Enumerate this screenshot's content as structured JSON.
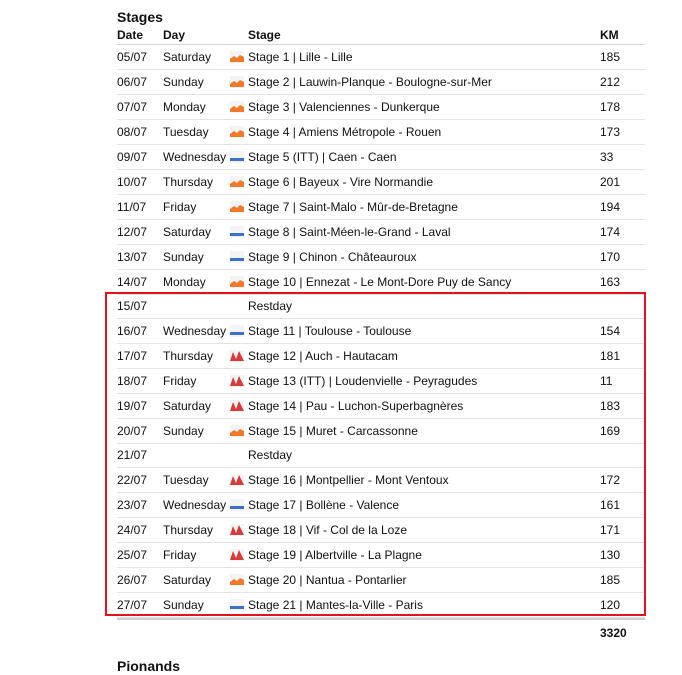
{
  "section_title": "Stages",
  "columns": {
    "date": "Date",
    "day": "Day",
    "stage": "Stage",
    "km": "KM"
  },
  "stages": [
    {
      "date": "05/07",
      "day": "Saturday",
      "icon": "hilly-profile-icon",
      "stage": "Stage 1 | Lille - Lille",
      "km": "185"
    },
    {
      "date": "06/07",
      "day": "Sunday",
      "icon": "hilly-profile-icon",
      "stage": "Stage 2 | Lauwin-Planque - Boulogne-sur-Mer",
      "km": "212"
    },
    {
      "date": "07/07",
      "day": "Monday",
      "icon": "hilly-profile-icon",
      "stage": "Stage 3 | Valenciennes - Dunkerque",
      "km": "178"
    },
    {
      "date": "08/07",
      "day": "Tuesday",
      "icon": "hilly-profile-icon",
      "stage": "Stage 4 | Amiens Métropole - Rouen",
      "km": "173"
    },
    {
      "date": "09/07",
      "day": "Wednesday",
      "icon": "flat-profile-icon",
      "stage": "Stage 5 (ITT) | Caen - Caen",
      "km": "33"
    },
    {
      "date": "10/07",
      "day": "Thursday",
      "icon": "hilly-profile-icon",
      "stage": "Stage 6 | Bayeux - Vire Normandie",
      "km": "201"
    },
    {
      "date": "11/07",
      "day": "Friday",
      "icon": "hilly-profile-icon",
      "stage": "Stage 7 | Saint-Malo - Mûr-de-Bretagne",
      "km": "194"
    },
    {
      "date": "12/07",
      "day": "Saturday",
      "icon": "flat-profile-icon",
      "stage": "Stage 8 | Saint-Méen-le-Grand - Laval",
      "km": "174"
    },
    {
      "date": "13/07",
      "day": "Sunday",
      "icon": "flat-profile-icon",
      "stage": "Stage 9 | Chinon - Châteauroux",
      "km": "170"
    },
    {
      "date": "14/07",
      "day": "Monday",
      "icon": "hilly-profile-icon",
      "stage": "Stage 10 | Ennezat - Le Mont-Dore Puy de Sancy",
      "km": "163"
    },
    {
      "date": "15/07",
      "day": "",
      "icon": "",
      "stage": "Restday",
      "km": "",
      "rest": true
    },
    {
      "date": "16/07",
      "day": "Wednesday",
      "icon": "flat-profile-icon",
      "stage": "Stage 11 | Toulouse - Toulouse",
      "km": "154"
    },
    {
      "date": "17/07",
      "day": "Thursday",
      "icon": "mountain-profile-icon",
      "stage": "Stage 12 | Auch - Hautacam",
      "km": "181"
    },
    {
      "date": "18/07",
      "day": "Friday",
      "icon": "mountain-profile-icon",
      "stage": "Stage 13 (ITT) | Loudenvielle - Peyragudes",
      "km": "11"
    },
    {
      "date": "19/07",
      "day": "Saturday",
      "icon": "mountain-profile-icon",
      "stage": "Stage 14 | Pau - Luchon-Superbagnères",
      "km": "183"
    },
    {
      "date": "20/07",
      "day": "Sunday",
      "icon": "hilly-profile-icon",
      "stage": "Stage 15 | Muret - Carcassonne",
      "km": "169"
    },
    {
      "date": "21/07",
      "day": "",
      "icon": "",
      "stage": "Restday",
      "km": "",
      "rest": true
    },
    {
      "date": "22/07",
      "day": "Tuesday",
      "icon": "mountain-profile-icon",
      "stage": "Stage 16 | Montpellier - Mont Ventoux",
      "km": "172"
    },
    {
      "date": "23/07",
      "day": "Wednesday",
      "icon": "flat-profile-icon",
      "stage": "Stage 17 | Bollène - Valence",
      "km": "161"
    },
    {
      "date": "24/07",
      "day": "Thursday",
      "icon": "mountain-profile-icon",
      "stage": "Stage 18 | Vif - Col de la Loze",
      "km": "171"
    },
    {
      "date": "25/07",
      "day": "Friday",
      "icon": "mountain-profile-icon",
      "stage": "Stage 19 | Albertville - La Plagne",
      "km": "130"
    },
    {
      "date": "26/07",
      "day": "Saturday",
      "icon": "hilly-profile-icon",
      "stage": "Stage 20 | Nantua - Pontarlier",
      "km": "185"
    },
    {
      "date": "27/07",
      "day": "Sunday",
      "icon": "flat-profile-icon",
      "stage": "Stage 21 | Mantes-la-Ville - Paris",
      "km": "120"
    }
  ],
  "total_km": "3320",
  "next_section_title": "Pionands",
  "colors": {
    "hilly": "#f07a2a",
    "flat": "#3a6fd0",
    "mountain": "#d63a3a",
    "highlight": "#e3131b"
  }
}
